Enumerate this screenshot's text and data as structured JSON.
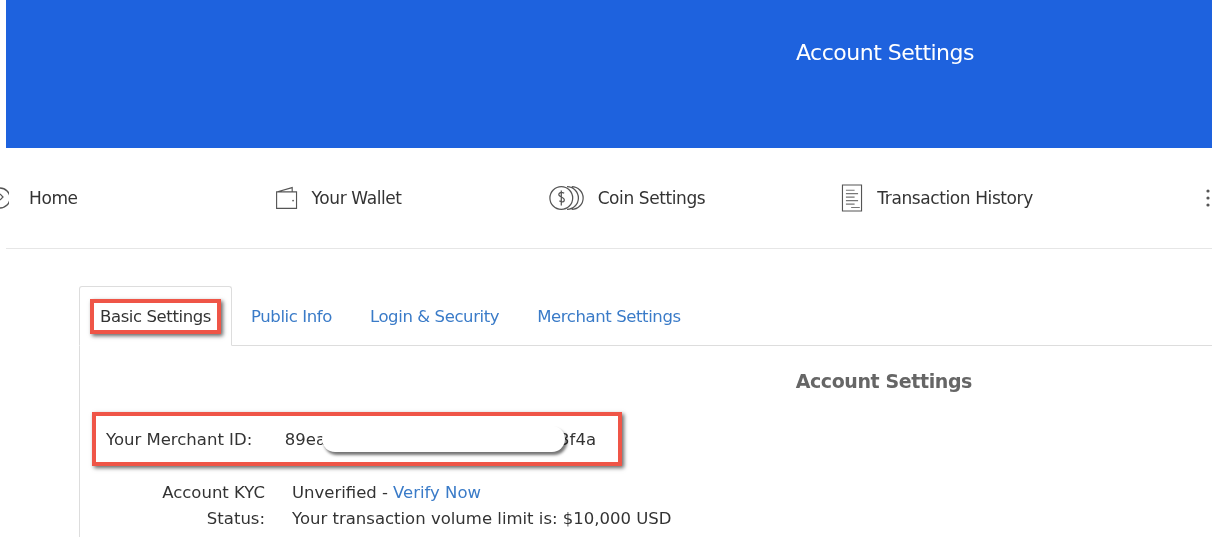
{
  "header": {
    "title": "Account Settings"
  },
  "nav": [
    {
      "label": "Home"
    },
    {
      "label": "Your Wallet"
    },
    {
      "label": "Coin Settings"
    },
    {
      "label": "Transaction History"
    }
  ],
  "tabs": [
    {
      "label": "Basic Settings",
      "selected": true,
      "highlighted": true
    },
    {
      "label": "Public Info",
      "selected": false,
      "highlighted": false
    },
    {
      "label": "Login & Security",
      "selected": false,
      "highlighted": false
    },
    {
      "label": "Merchant Settings",
      "selected": false,
      "highlighted": false
    }
  ],
  "panel": {
    "title": "Account Settings",
    "merchant_id": {
      "label": "Your Merchant ID:",
      "value_start": "89ea",
      "value_end": "3f4a",
      "redacted": true,
      "highlighted": true
    },
    "kyc": {
      "label_lines": [
        "Account KYC",
        "Status:"
      ],
      "status": "Unverified -",
      "link": "Verify Now",
      "note": "Your transaction volume limit is: $10,000 USD"
    }
  }
}
